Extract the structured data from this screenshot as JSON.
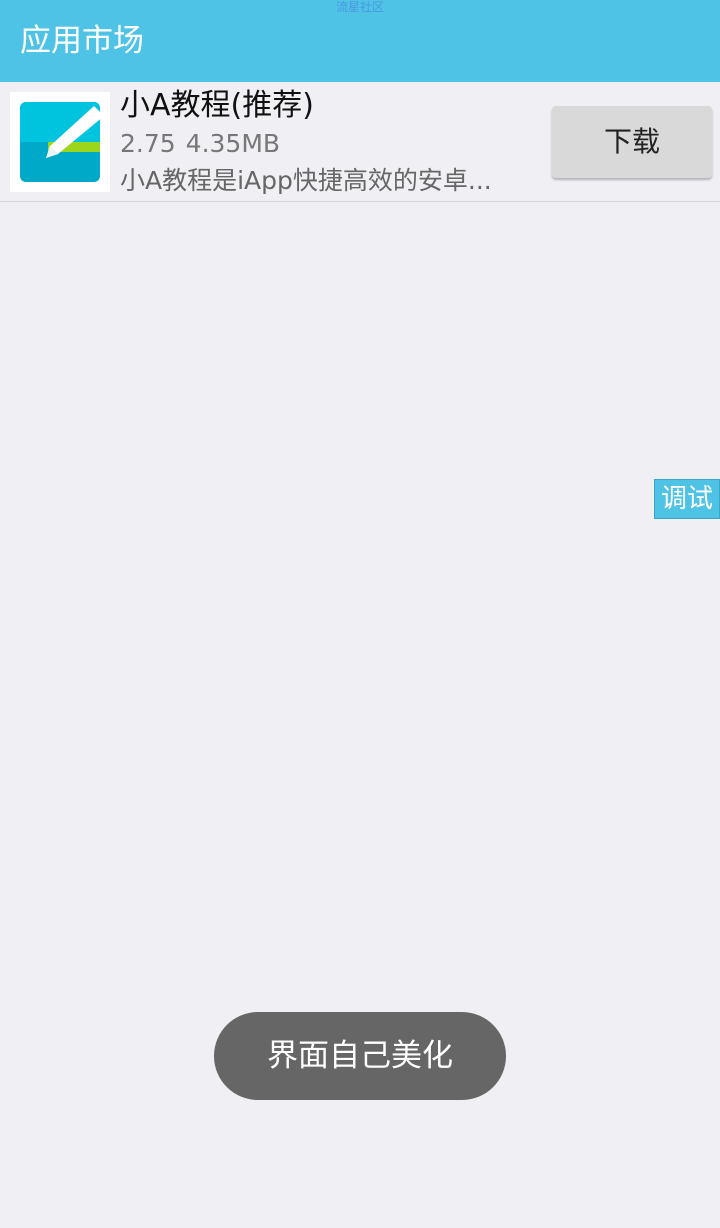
{
  "watermark": "流星社区",
  "header": {
    "title": "应用市场"
  },
  "app_list": [
    {
      "name": "小A教程(推荐)",
      "version": "2.75",
      "size": "4.35MB",
      "description": "小A教程是iApp快捷高效的安卓...",
      "download_label": "下载"
    }
  ],
  "debug_tab": {
    "label": "调试"
  },
  "toast": {
    "message": "界面自己美化"
  },
  "colors": {
    "accent": "#4fc3e6",
    "background": "#efeff4",
    "button": "#d9d9d9",
    "toast": "#666666"
  },
  "icons": {
    "app_icon": "pencil-app-icon"
  }
}
